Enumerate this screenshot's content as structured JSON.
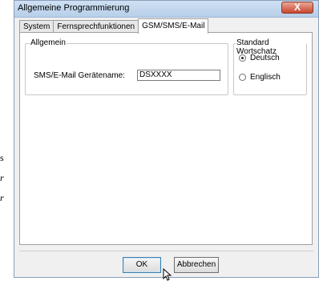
{
  "window": {
    "title": "Allgemeine Programmierung",
    "close_label": "X"
  },
  "edge_text": [
    "s",
    "r",
    "r"
  ],
  "tabs": [
    {
      "label": "System",
      "active": false
    },
    {
      "label": "Fernsprechfunktionen",
      "active": false
    },
    {
      "label": "GSM/SMS/E-Mail",
      "active": true
    }
  ],
  "general_group": {
    "title": "Allgemein",
    "device_name_label": "SMS/E-Mail Gerätename:",
    "device_name_value": "DSXXXX"
  },
  "vocab_group": {
    "title": "Standard Wortschatz",
    "options": [
      {
        "label": "Deutsch",
        "selected": true
      },
      {
        "label": "Englisch",
        "selected": false
      }
    ]
  },
  "buttons": {
    "ok": "OK",
    "cancel": "Abbrechen"
  }
}
